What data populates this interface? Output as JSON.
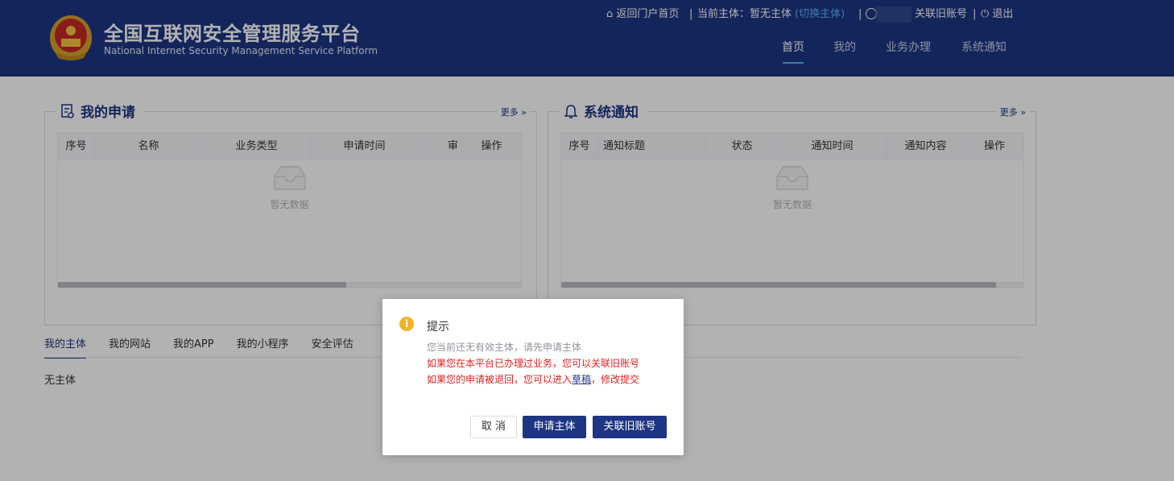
{
  "header": {
    "title_cn": "全国互联网安全管理服务平台",
    "title_en": "National Internet Security Management Service Platform",
    "home_link": "⌂ 返回门户首页",
    "entity_label": "当前主体：暂无主体",
    "switch_entity": "(切换主体)",
    "link_old_account": "关联旧账号",
    "logout": "⏻ 退出",
    "separator": "|",
    "nav": [
      "首页",
      "我的",
      "业务办理",
      "系统通知"
    ],
    "nav_active": "首页",
    "colors": {
      "header_bg": "#1e3584",
      "accent": "#5ab0f0"
    }
  },
  "my_applications": {
    "title": "我的申请",
    "more": "更多 »",
    "columns": [
      "序号",
      "名称",
      "业务类型",
      "申请时间",
      "审",
      "操作"
    ],
    "empty_text": "暂无数据"
  },
  "system_notices": {
    "title": "系统通知",
    "more": "更多 »",
    "columns": [
      "序号",
      "通知标题",
      "状态",
      "通知时间",
      "通知内容",
      "操作"
    ],
    "empty_text": "暂无数据"
  },
  "tabs": {
    "items": [
      "我的主体",
      "我的网站",
      "我的APP",
      "我的小程序",
      "安全评估"
    ],
    "active": "我的主体",
    "content": "无主体"
  },
  "dialog": {
    "title": "提示",
    "icon": "info-icon",
    "line1": "您当前还无有效主体，请先申请主体",
    "line2": "如果您在本平台已办理过业务，您可以关联旧账号",
    "line3_pre": "如果您的申请被退回，您可以进入",
    "line3_link": "草稿",
    "line3_post": "，修改提交",
    "buttons": {
      "cancel": "取 消",
      "apply": "申请主体",
      "link_old": "关联旧账号"
    }
  }
}
